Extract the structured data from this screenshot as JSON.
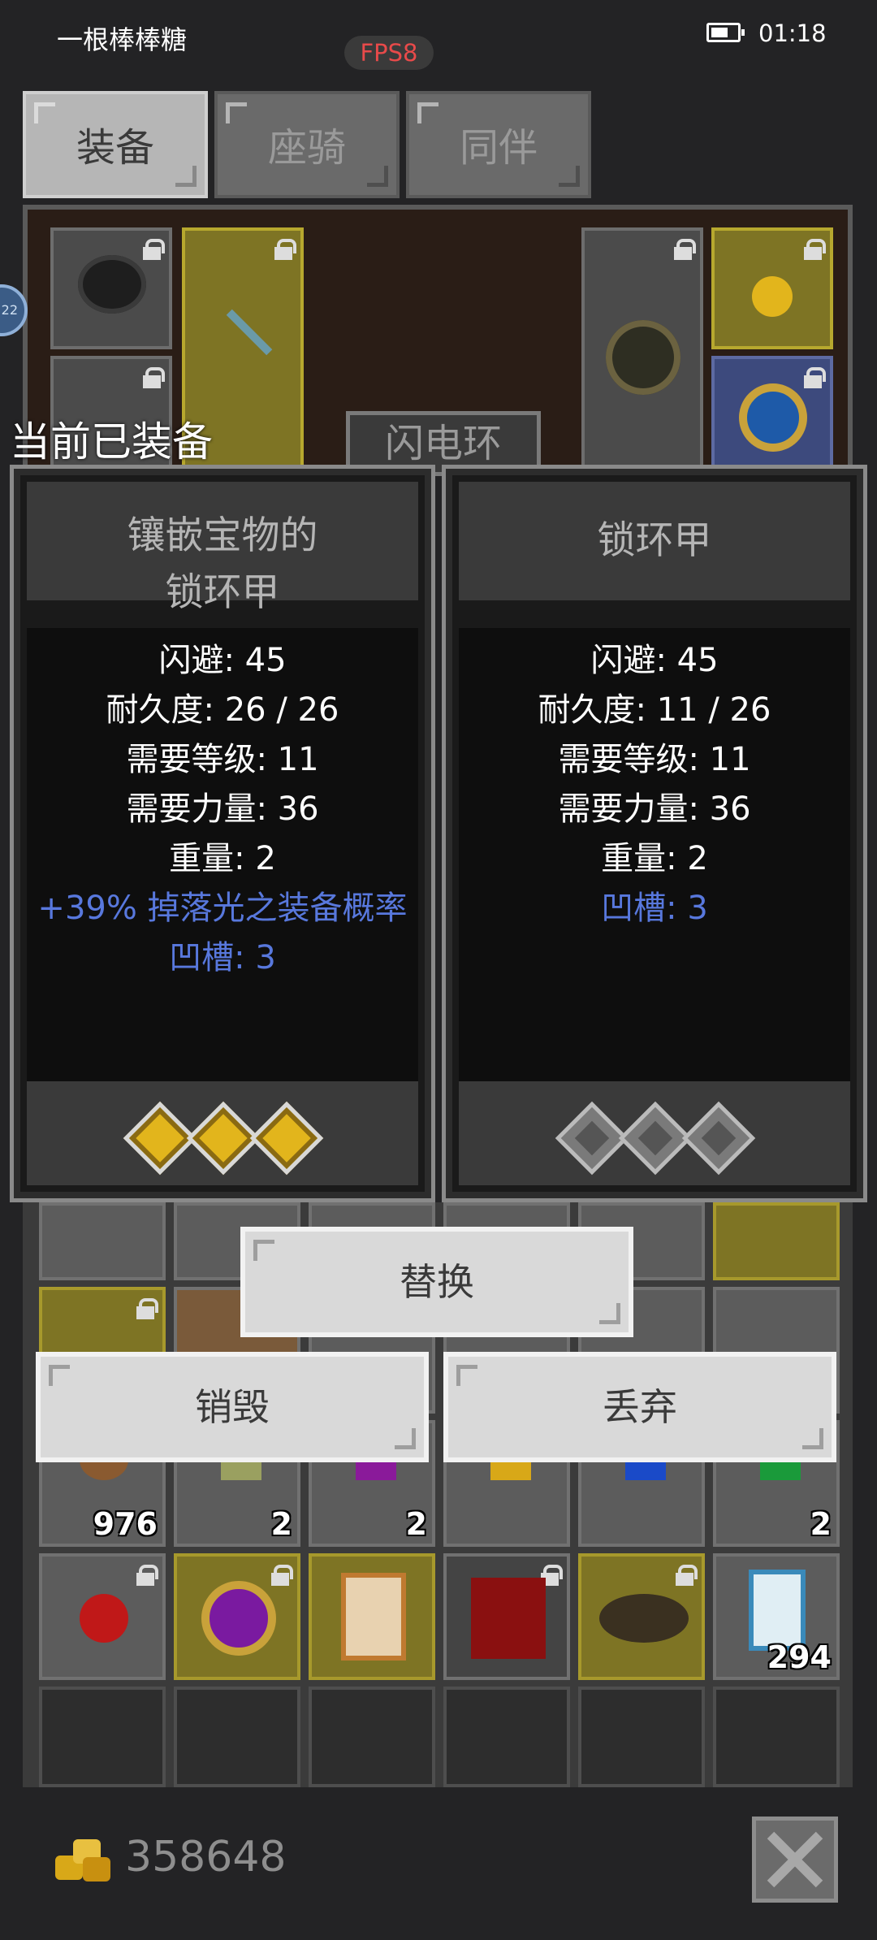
{
  "status_bar": {
    "app_name": "一根棒棒糖",
    "fps": "FPS8",
    "time": "01:18"
  },
  "tabs": [
    {
      "label": "装备",
      "active": true
    },
    {
      "label": "座骑",
      "active": false
    },
    {
      "label": "同伴",
      "active": false
    }
  ],
  "equip_panel": {
    "center_label": "闪电环"
  },
  "side_badge": "22",
  "tooltip": {
    "header": "当前已装备",
    "equipped": {
      "name_line1": "镶嵌宝物的",
      "name_line2": "锁环甲",
      "stats": [
        "闪避: 45",
        "耐久度: 26 / 26",
        "需要等级: 11",
        "需要力量: 36",
        "重量: 2"
      ],
      "bonus": "+39% 掉落光之装备概率",
      "sockets": "凹槽: 3",
      "gems": [
        "gold",
        "gold",
        "gold"
      ]
    },
    "compare": {
      "name": "锁环甲",
      "stats": [
        "闪避: 45",
        "耐久度: 11 / 26",
        "需要等级: 11",
        "需要力量: 36",
        "重量: 2"
      ],
      "sockets": "凹槽: 3",
      "gems": [
        "empty",
        "empty",
        "empty"
      ]
    }
  },
  "actions": {
    "replace": "替换",
    "destroy": "销毁",
    "discard": "丢弃"
  },
  "inventory": {
    "counts": {
      "ore": "976",
      "leaf": "2",
      "purple_gem": "2",
      "green_gem": "2",
      "scroll": "294"
    }
  },
  "footer": {
    "gold": "358648"
  },
  "colors": {
    "blue_text": "#5878dd",
    "gold_slot": "#7e7424",
    "fps_red": "#e84a4a"
  }
}
